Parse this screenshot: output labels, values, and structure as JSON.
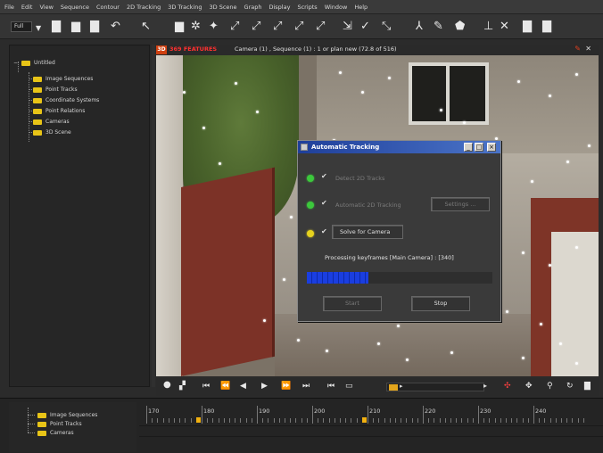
{
  "menu": [
    "File",
    "Edit",
    "View",
    "Sequence",
    "Contour",
    "2D Tracking",
    "3D Tracking",
    "3D Scene",
    "Graph",
    "Display",
    "Scripts",
    "Window",
    "Help"
  ],
  "toolbar": {
    "dropdown_value": "Full"
  },
  "tree": {
    "root": "Untitled",
    "items": [
      "Image Sequences",
      "Point Tracks",
      "Coordinate Systems",
      "Point Relations",
      "Cameras",
      "3D Scene"
    ]
  },
  "viewport": {
    "badge": "3D",
    "status_red": "369 FEATURES",
    "header_text": "Camera (1) , Sequence (1) : 1 or plan new (72.8 of 516)"
  },
  "dialog": {
    "title": "Automatic Tracking",
    "minimize": "_",
    "maximize": "□",
    "close": "×",
    "steps": [
      {
        "label": "Detect 2D Tracks",
        "led_color": "#3cc83c",
        "checked": true,
        "enabled": false
      },
      {
        "label": "Automatic 2D Tracking",
        "led_color": "#3cc83c",
        "checked": true,
        "enabled": false,
        "button": "Settings ..."
      },
      {
        "label": "Solve for Camera",
        "led_color": "#e6d21e",
        "checked": true,
        "enabled": true
      }
    ],
    "status": "Processing keyframes [Main Camera] : [340]",
    "progress": 0.33,
    "start_button": "Start",
    "stop_button": "Stop"
  },
  "bottom_tree": {
    "items": [
      "Image Sequences",
      "Point Tracks",
      "Cameras"
    ]
  },
  "timeline": {
    "ticks": [
      "170",
      "180",
      "190",
      "200",
      "210",
      "220",
      "230",
      "240"
    ],
    "keyframes_near": [
      "180",
      "210"
    ]
  }
}
